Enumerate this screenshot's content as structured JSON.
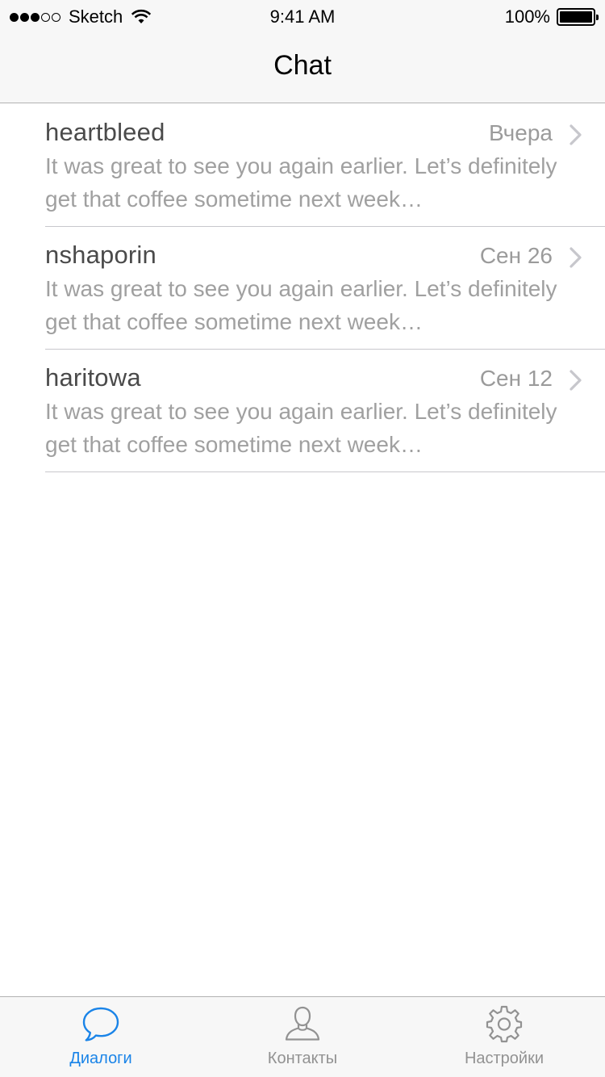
{
  "status_bar": {
    "carrier": "Sketch",
    "time": "9:41 AM",
    "battery_percent": "100%",
    "signal_bars_filled": 3,
    "signal_bars_total": 5,
    "battery_level": 1.0
  },
  "nav": {
    "title": "Chat"
  },
  "chats": [
    {
      "name": "heartbleed",
      "date": "Вчера",
      "preview": "It was great to see you again earlier. Let’s definitely get that coffee sometime next week…"
    },
    {
      "name": "nshaporin",
      "date": "Сен 26",
      "preview": "It was great to see you again earlier. Let’s definitely get that coffee sometime next week…"
    },
    {
      "name": "haritowa",
      "date": "Сен 12",
      "preview": "It was great to see you again earlier. Let’s definitely get that coffee sometime next week…"
    }
  ],
  "tab_bar": {
    "items": [
      {
        "label": "Диалоги",
        "icon": "chat-bubble-icon",
        "active": true
      },
      {
        "label": "Контакты",
        "icon": "person-icon",
        "active": false
      },
      {
        "label": "Настройки",
        "icon": "gear-icon",
        "active": false
      }
    ]
  },
  "colors": {
    "accent": "#1a84e8",
    "inactive_tab": "#929292",
    "name_text": "#4a4a4a",
    "secondary_text": "#a0a0a0",
    "bar_background": "#f7f7f7"
  }
}
